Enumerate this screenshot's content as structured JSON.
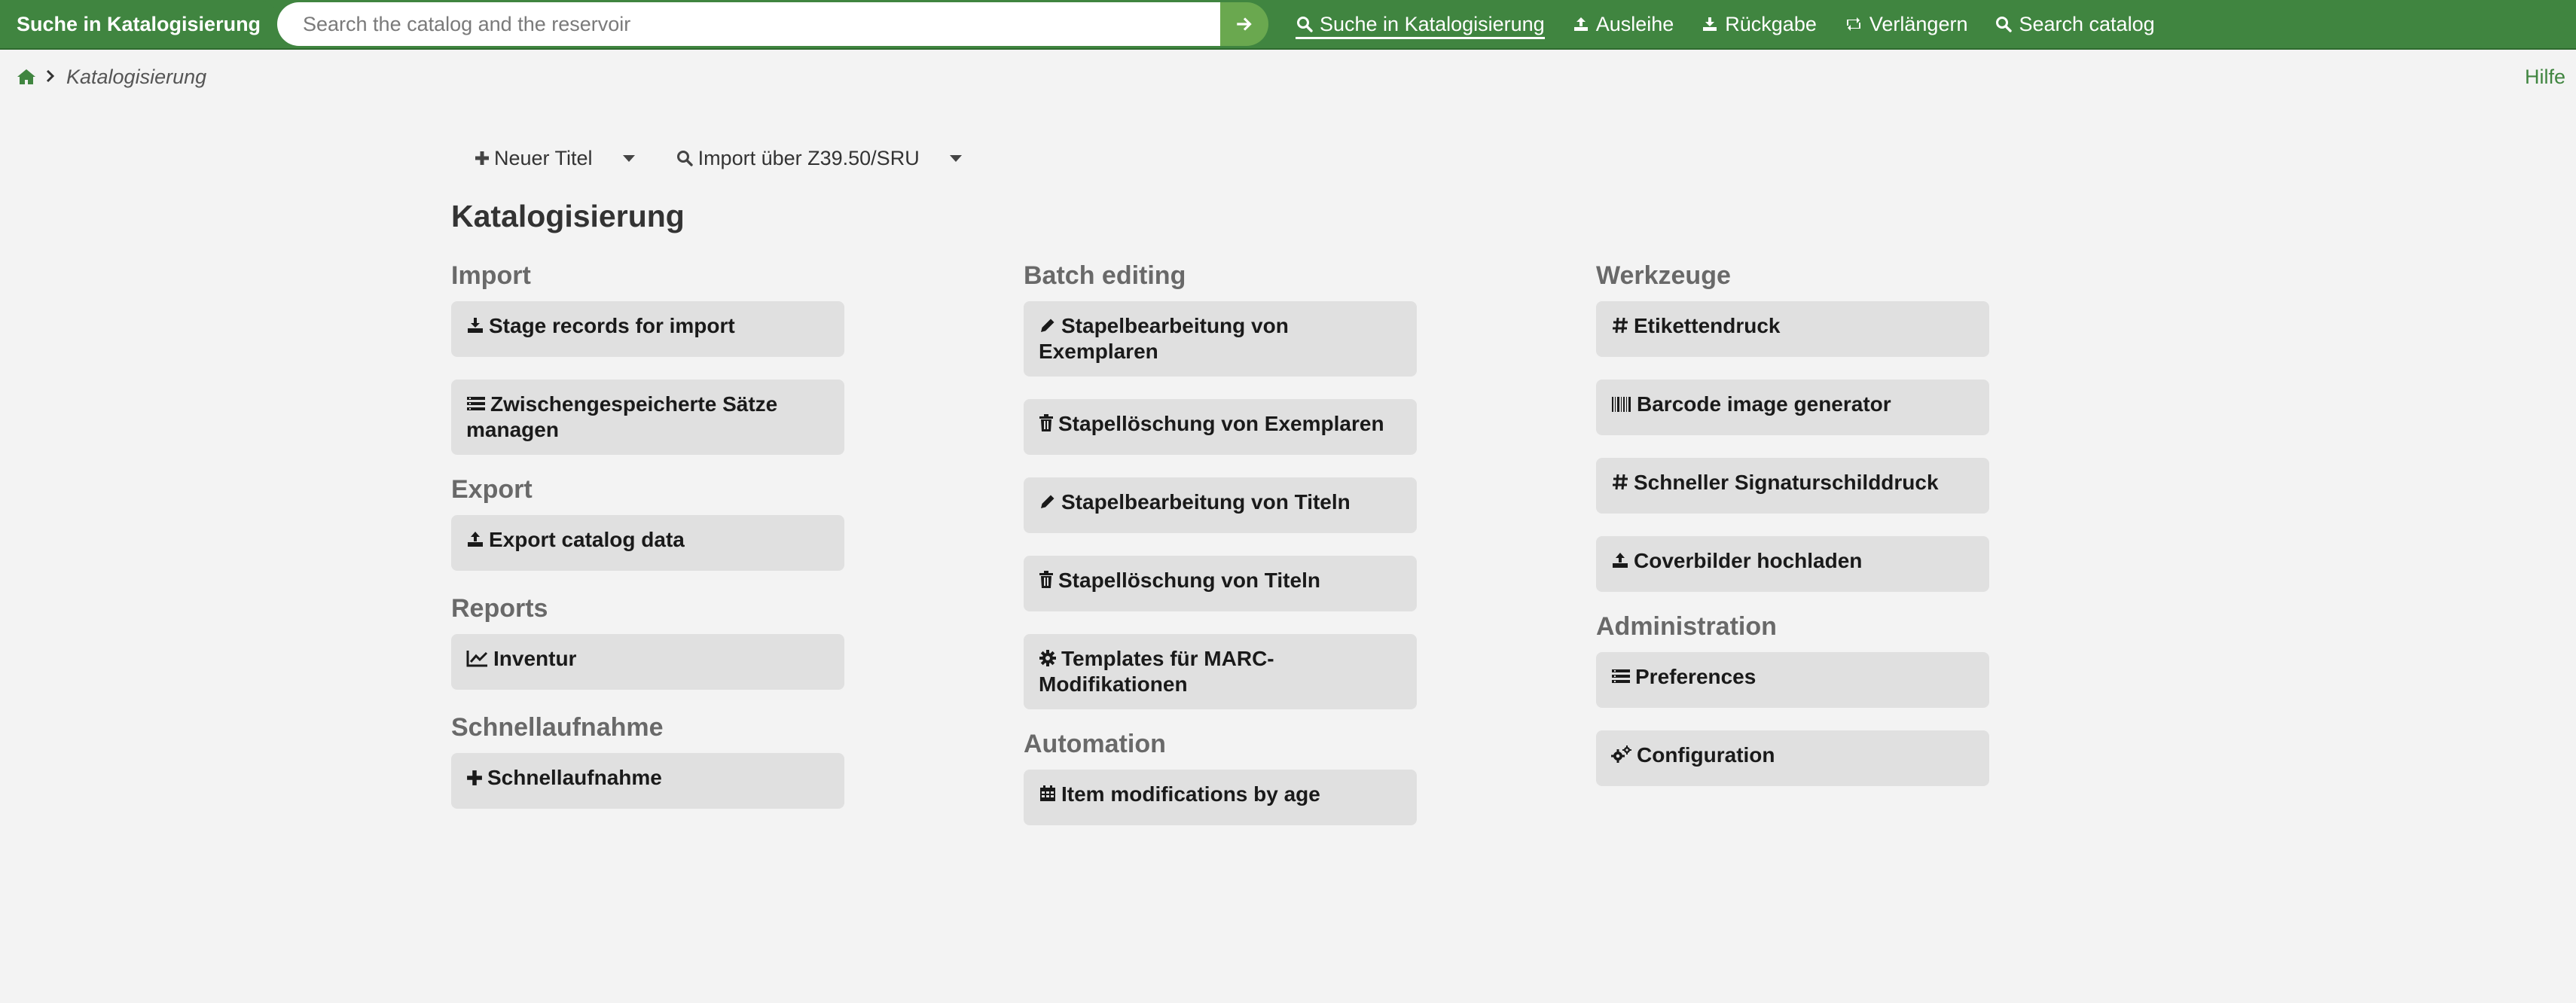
{
  "header": {
    "search_label": "Suche in Katalogisierung",
    "search_placeholder": "Search the catalog and the reservoir",
    "nav": [
      {
        "label": "Suche in Katalogisierung",
        "icon": "search-icon",
        "active": true
      },
      {
        "label": "Ausleihe",
        "icon": "upload-icon"
      },
      {
        "label": "Rückgabe",
        "icon": "download-icon"
      },
      {
        "label": "Verlängern",
        "icon": "retweet-icon"
      },
      {
        "label": "Search catalog",
        "icon": "search-icon"
      }
    ]
  },
  "breadcrumb": {
    "home_icon": "home-icon",
    "current": "Katalogisierung"
  },
  "help": "Hilfe",
  "toolbar": {
    "new_title": "Neuer Titel",
    "import_z3950": "Import über Z39.50/SRU"
  },
  "page_title": "Katalogisierung",
  "columns": [
    {
      "sections": [
        {
          "heading": "Import",
          "items": [
            {
              "label": "Stage records for import",
              "icon": "download-icon"
            },
            {
              "label": "Zwischengespeicherte Sätze managen",
              "icon": "list-icon"
            }
          ]
        },
        {
          "heading": "Export",
          "items": [
            {
              "label": "Export catalog data",
              "icon": "upload-icon"
            }
          ]
        },
        {
          "heading": "Reports",
          "items": [
            {
              "label": "Inventur",
              "icon": "line-chart-icon"
            }
          ]
        },
        {
          "heading": "Schnellaufnahme",
          "items": [
            {
              "label": "Schnellaufnahme",
              "icon": "plus-icon"
            }
          ]
        }
      ]
    },
    {
      "sections": [
        {
          "heading": "Batch editing",
          "items": [
            {
              "label": "Stapelbearbeitung von Exemplaren",
              "icon": "pencil-icon"
            },
            {
              "label": "Stapellöschung von Exemplaren",
              "icon": "trash-icon"
            },
            {
              "label": "Stapelbearbeitung von Titeln",
              "icon": "pencil-icon"
            },
            {
              "label": "Stapellöschung von Titeln",
              "icon": "trash-icon"
            },
            {
              "label": "Templates für MARC-Modifikationen",
              "icon": "gear-icon"
            }
          ]
        },
        {
          "heading": "Automation",
          "items": [
            {
              "label": "Item modifications by age",
              "icon": "calendar-icon"
            }
          ]
        }
      ]
    },
    {
      "sections": [
        {
          "heading": "Werkzeuge",
          "items": [
            {
              "label": "Etikettendruck",
              "icon": "hashtag-icon"
            },
            {
              "label": "Barcode image generator",
              "icon": "barcode-icon"
            },
            {
              "label": "Schneller Signaturschilddruck",
              "icon": "hashtag-icon"
            },
            {
              "label": "Coverbilder hochladen",
              "icon": "upload-icon"
            }
          ]
        },
        {
          "heading": "Administration",
          "items": [
            {
              "label": "Preferences",
              "icon": "list-icon"
            },
            {
              "label": "Configuration",
              "icon": "gears-icon"
            }
          ]
        }
      ]
    }
  ],
  "colors": {
    "brand_green": "#408540",
    "tile_bg": "#e0e0e0",
    "page_bg": "#f3f3f3",
    "heading_gray": "#696969"
  }
}
